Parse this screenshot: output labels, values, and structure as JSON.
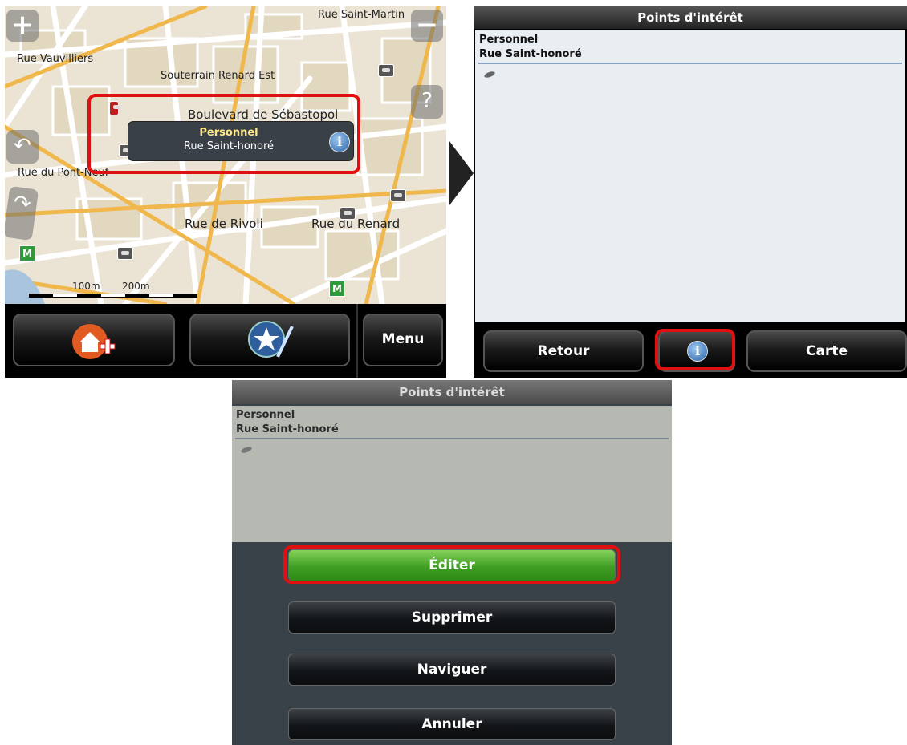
{
  "map": {
    "streets": {
      "saint_martin": "Rue Saint-Martin",
      "vauvilliers": "Rue Vauvilliers",
      "souterrain": "Souterrain Renard Est",
      "sebastopol": "Boulevard de Sébastopol",
      "pont_neuf": "Rue du Pont-Neuf",
      "rivoli": "Rue de Rivoli",
      "renard": "Rue du Renard"
    },
    "zoom_in": "+",
    "zoom_out": "−",
    "callout": {
      "title": "Personnel",
      "subtitle": "Rue Saint-honoré",
      "info": "i"
    },
    "scale": {
      "first": "100m",
      "second": "200m"
    },
    "toolbar": {
      "menu_label": "Menu",
      "home_icon": "home-add-icon",
      "fav_icon": "favorite-edit-icon"
    }
  },
  "poi_list": {
    "title": "Points d'intérêt",
    "item": {
      "name": "Personnel",
      "address": "Rue Saint-honoré"
    },
    "toolbar": {
      "back_label": "Retour",
      "info": "i",
      "map_label": "Carte"
    }
  },
  "menu": {
    "title": "Points d'intérêt",
    "item": {
      "name": "Personnel",
      "address": "Rue Saint-honoré"
    },
    "buttons": {
      "edit": "Éditer",
      "delete": "Supprimer",
      "navigate": "Naviguer",
      "cancel": "Annuler"
    }
  },
  "colors": {
    "highlight": "#e01010",
    "edit_button": "#4ca828",
    "callout_title": "#ffe98a"
  }
}
